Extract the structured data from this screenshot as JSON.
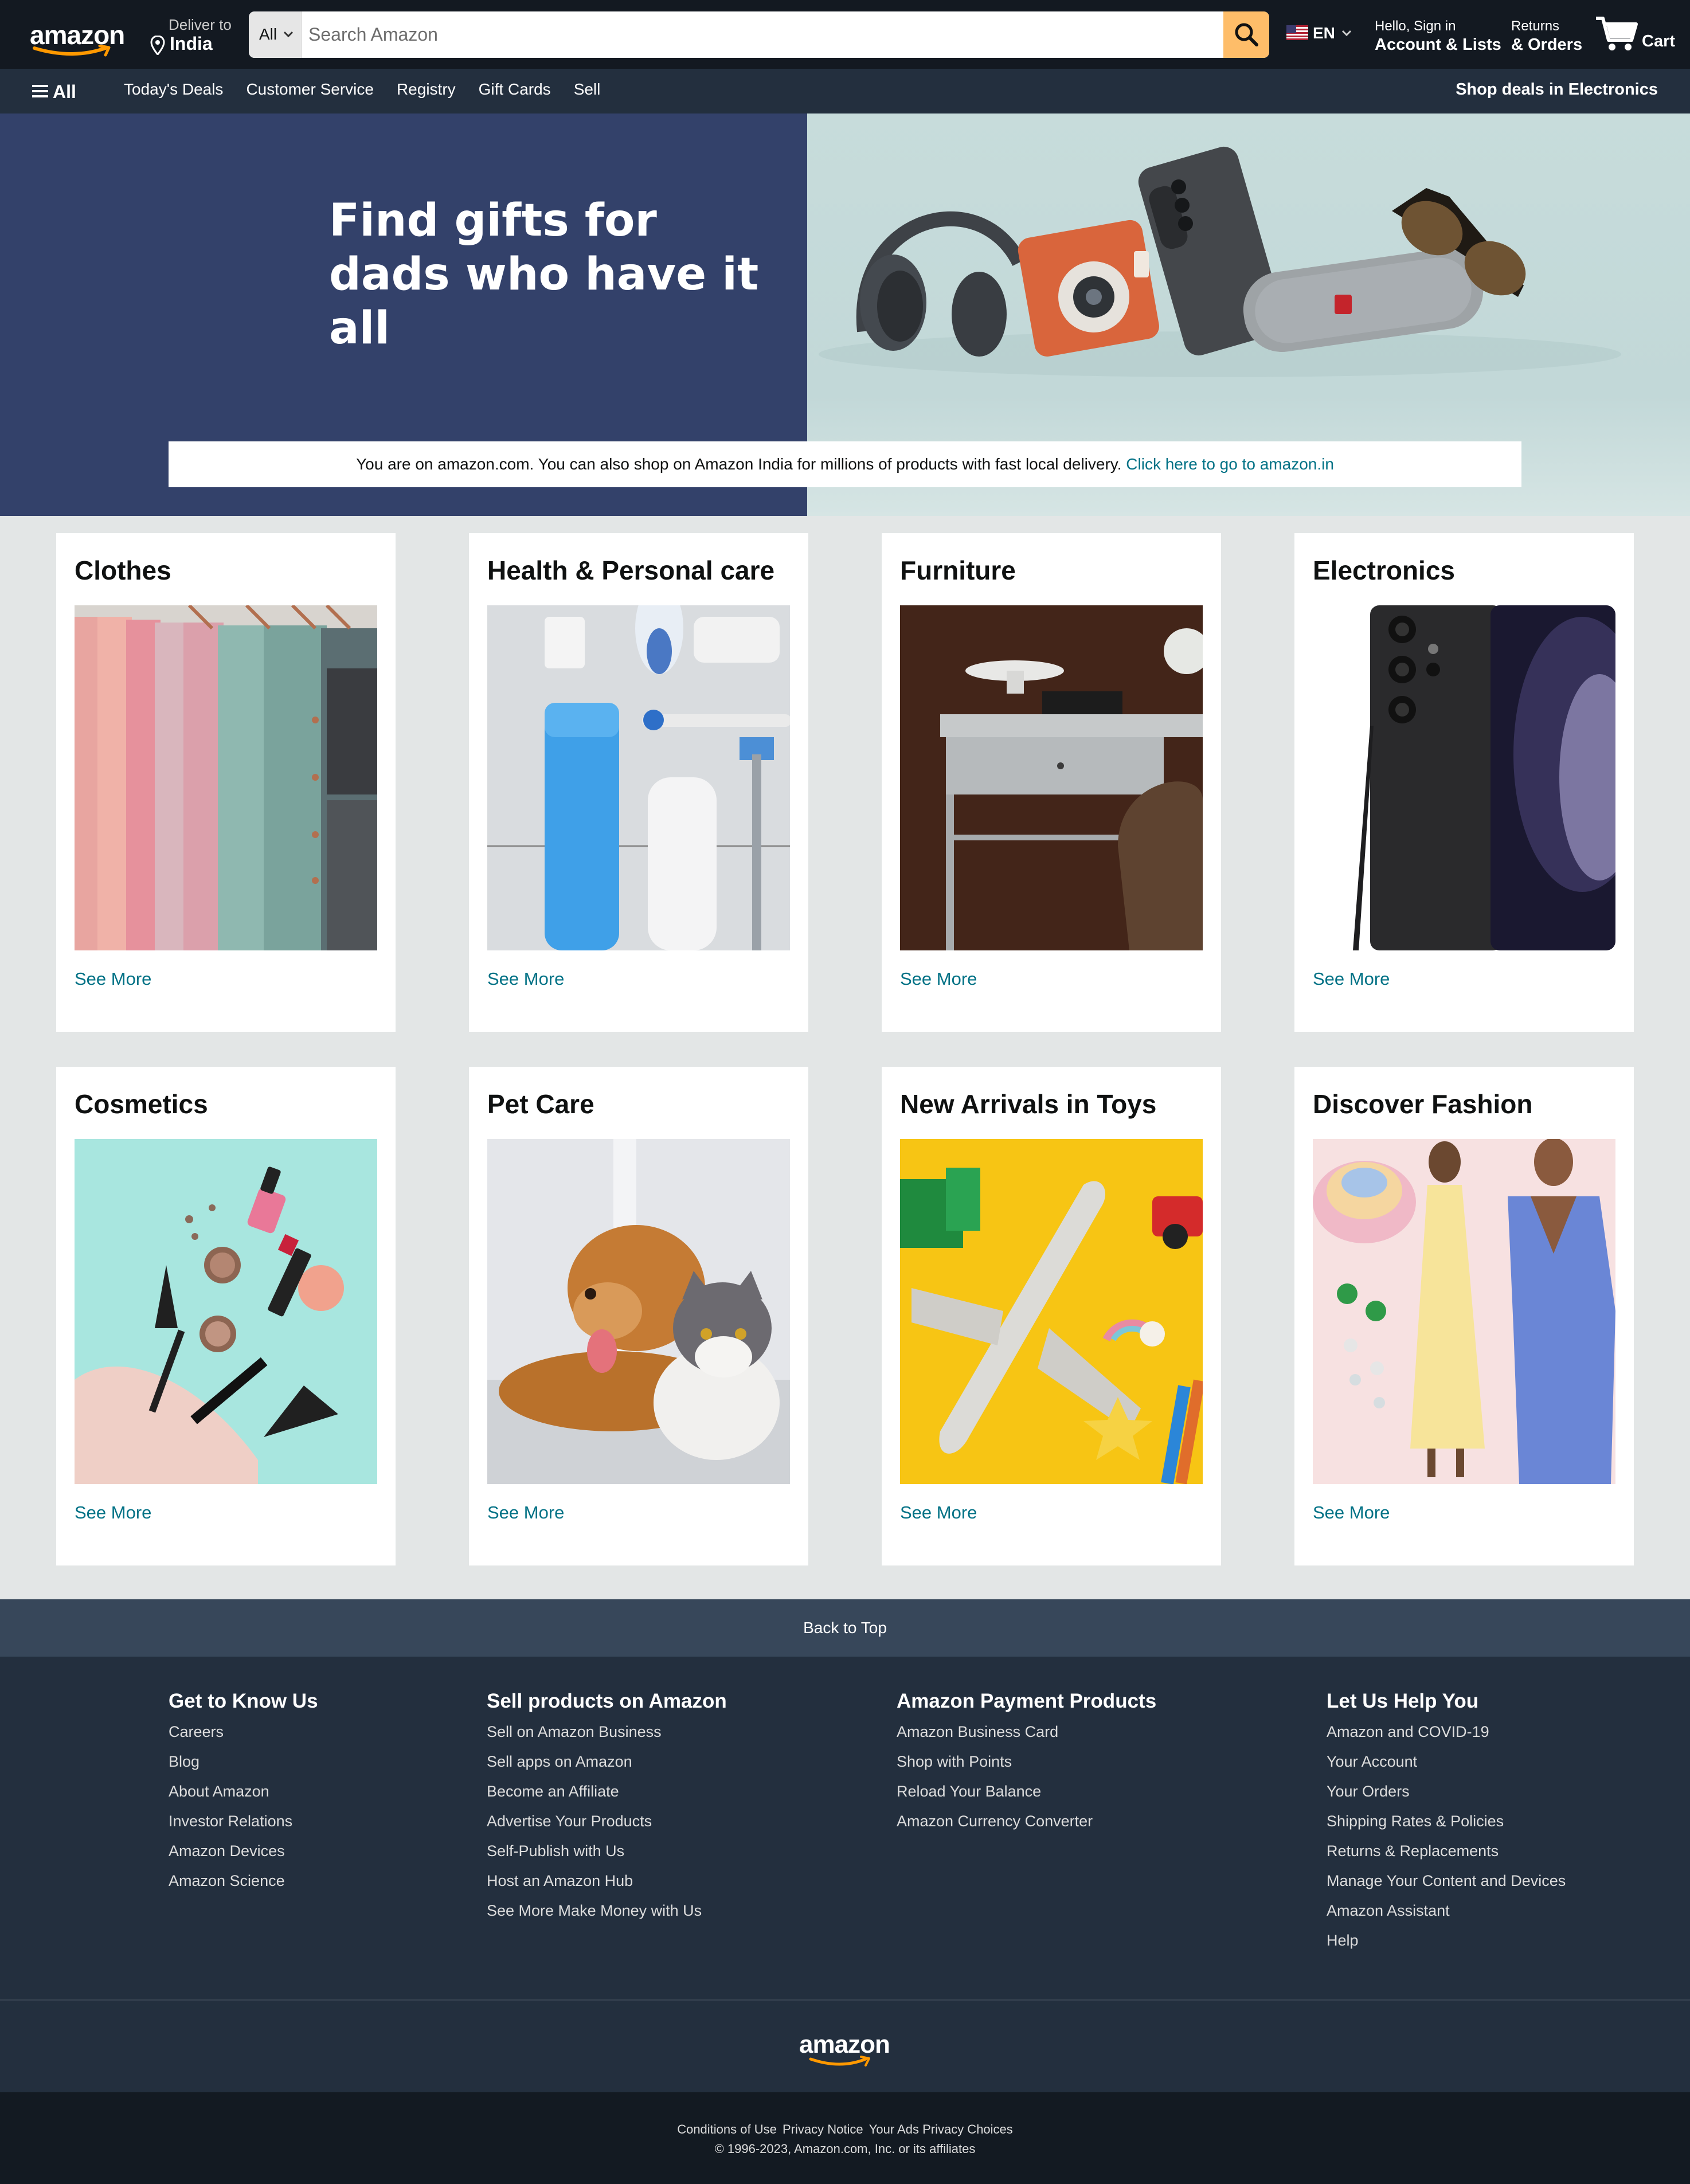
{
  "header": {
    "logo_text": "amazon",
    "deliver_label": "Deliver to",
    "deliver_location": "India",
    "search": {
      "category": "All",
      "placeholder": "Search Amazon"
    },
    "language": "EN",
    "account_greeting": "Hello, Sign in",
    "account_label": "Account & Lists",
    "returns_label": "Returns",
    "orders_label": "& Orders",
    "cart_label": "Cart"
  },
  "subnav": {
    "all_label": "All",
    "links": [
      "Today's Deals",
      "Customer Service",
      "Registry",
      "Gift Cards",
      "Sell"
    ],
    "promo": "Shop deals in Electronics"
  },
  "hero": {
    "headline_line1": "Find gifts for",
    "headline_line2": "dads who have it all",
    "notice_text": "You are on amazon.com. You can also shop on Amazon India for millions of products with fast local delivery.",
    "notice_link": "Click here to go to amazon.in"
  },
  "cards": [
    {
      "title": "Clothes",
      "link": "See More"
    },
    {
      "title": "Health & Personal care",
      "link": "See More"
    },
    {
      "title": "Furniture",
      "link": "See More"
    },
    {
      "title": "Electronics",
      "link": "See More"
    },
    {
      "title": "Cosmetics",
      "link": "See More"
    },
    {
      "title": "Pet Care",
      "link": "See More"
    },
    {
      "title": "New Arrivals in Toys",
      "link": "See More"
    },
    {
      "title": "Discover Fashion",
      "link": "See More"
    }
  ],
  "footer": {
    "back_to_top": "Back to Top",
    "columns": [
      {
        "heading": "Get to Know Us",
        "items": [
          "Careers",
          "Blog",
          "About Amazon",
          "Investor Relations",
          "Amazon Devices",
          "Amazon Science"
        ]
      },
      {
        "heading": "Sell products on Amazon",
        "items": [
          "Sell on Amazon Business",
          "Sell apps on Amazon",
          "Become an Affiliate",
          "Advertise Your Products",
          "Self-Publish with Us",
          "Host an Amazon Hub",
          "See More Make Money with Us"
        ]
      },
      {
        "heading": "Amazon Payment Products",
        "items": [
          "Amazon Business Card",
          "Shop with Points",
          "Reload Your Balance",
          "Amazon Currency Converter"
        ]
      },
      {
        "heading": "Let Us Help You",
        "items": [
          "Amazon and COVID-19",
          "Your Account",
          "Your Orders",
          "Shipping Rates & Policies",
          "Returns & Replacements",
          "Manage Your Content and Devices",
          "Amazon Assistant",
          "Help"
        ]
      }
    ],
    "logo_text": "amazon",
    "legal_links": [
      "Conditions of Use",
      "Privacy Notice",
      "Your Ads Privacy Choices"
    ],
    "copyright": "© 1996-2023, Amazon.com, Inc. or its affiliates"
  },
  "colors": {
    "nav_bg": "#131921",
    "subnav_bg": "#232f3e",
    "search_button": "#febd69",
    "hero_left": "#33416a",
    "link": "#007185",
    "page_bg": "#e3e6e6",
    "back_to_top_bg": "#37475a",
    "bottom_bg": "#131a22"
  }
}
